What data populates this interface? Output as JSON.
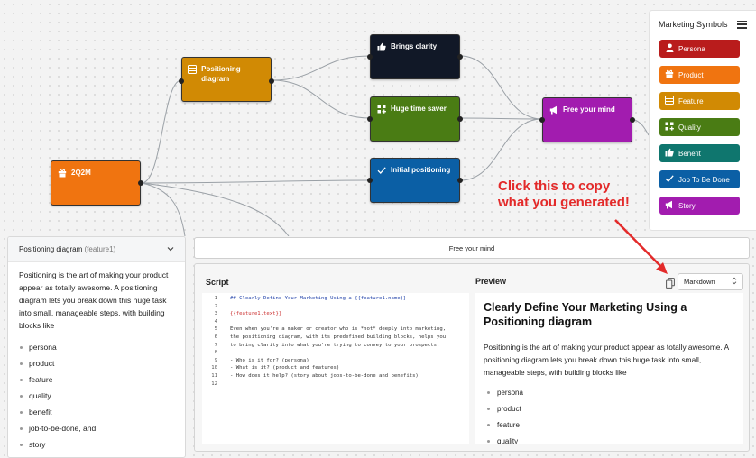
{
  "colors": {
    "persona": "#b91c1c",
    "product": "#f07410",
    "feature": "#d18a04",
    "quality": "#4a7c14",
    "benefit": "#0f766e",
    "job": "#0b5fa5",
    "story": "#a21caf",
    "dark": "#111827",
    "annotation": "#e32a2a"
  },
  "nodes": {
    "positioning": {
      "label": "Positioning diagram",
      "icon": "table-icon"
    },
    "clarity": {
      "label": "Brings clarity",
      "icon": "thumbs-up-icon"
    },
    "timesaver": {
      "label": "Huge time saver",
      "icon": "apps-plus-icon"
    },
    "initial": {
      "label": "Initial positioning",
      "icon": "check-icon"
    },
    "freemind": {
      "label": "Free your mind",
      "icon": "megaphone-icon"
    },
    "q2m": {
      "label": "2Q2M",
      "icon": "gift-icon"
    }
  },
  "symbols": {
    "title": "Marketing Symbols",
    "items": [
      {
        "label": "Persona",
        "icon": "person-icon"
      },
      {
        "label": "Product",
        "icon": "gift-icon"
      },
      {
        "label": "Feature",
        "icon": "table-icon"
      },
      {
        "label": "Quality",
        "icon": "apps-plus-icon"
      },
      {
        "label": "Benefit",
        "icon": "thumbs-up-icon"
      },
      {
        "label": "Job To Be Done",
        "icon": "check-icon"
      },
      {
        "label": "Story",
        "icon": "megaphone-icon"
      }
    ]
  },
  "annotation": {
    "line1": "Click this to copy",
    "line2": "what you generated!"
  },
  "left_panel": {
    "title": "Positioning diagram",
    "subtitle": "(feature1)",
    "description": "Positioning is the art of making your product appear as totally awesome. A positioning diagram lets you break down this huge task into small, manageable steps, with building blocks like",
    "items": [
      "persona",
      "product",
      "feature",
      "quality",
      "benefit",
      "job-to-be-done, and",
      "story"
    ]
  },
  "selected_node_bar": "Free your mind",
  "script": {
    "label": "Script",
    "lines": [
      "## Clearly Define Your Marketing Using a {{feature1.name}}",
      "",
      "{{feature1.text}}",
      "",
      "Even when you're a maker or creator who is *not* deeply into marketing,",
      "the positioning diagram, with its predefined building blocks, helps you",
      "to bring clarity into what you're trying to convey to your prospects:",
      "",
      "- Who is it for? (persona)",
      "- What is it? (product and features)",
      "- How does it help? (story about jobs-to-be-done and benefits)",
      ""
    ]
  },
  "preview": {
    "label": "Preview",
    "format": "Markdown",
    "heading": "Clearly Define Your Marketing Using a Positioning diagram",
    "paragraph": "Positioning is the art of making your product appear as totally awesome. A positioning diagram lets you break down this huge task into small, manageable steps, with building blocks like",
    "items": [
      "persona",
      "product",
      "feature",
      "quality"
    ]
  }
}
